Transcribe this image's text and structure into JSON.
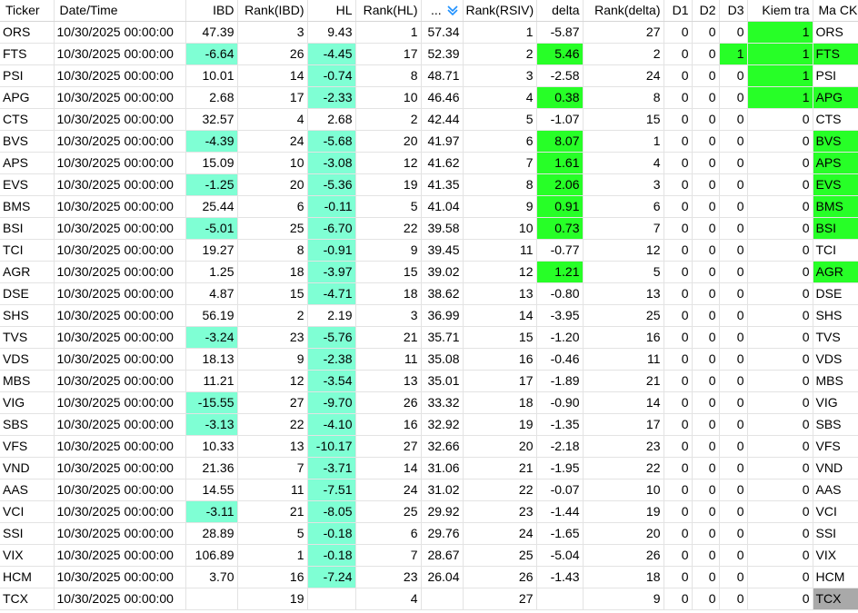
{
  "colors": {
    "aqua_highlight": "#7fffd4",
    "green_highlight": "#27ff27",
    "gray_highlight": "#a9a9a9",
    "sort_icon": "#1e90ff"
  },
  "columns": [
    {
      "key": "ticker",
      "label": "Ticker",
      "align": "left"
    },
    {
      "key": "datetime",
      "label": "Date/Time",
      "align": "left"
    },
    {
      "key": "ibd",
      "label": "IBD",
      "align": "right"
    },
    {
      "key": "rank_ibd",
      "label": "Rank(IBD)",
      "align": "right"
    },
    {
      "key": "hl",
      "label": "HL",
      "align": "right"
    },
    {
      "key": "rank_hl",
      "label": "Rank(HL)",
      "align": "right"
    },
    {
      "key": "rsiv",
      "label": "...",
      "align": "right",
      "sort_icon": "sort-descending-icon"
    },
    {
      "key": "rank_rsiv",
      "label": "Rank(RSIV)",
      "align": "right"
    },
    {
      "key": "delta",
      "label": "delta",
      "align": "right"
    },
    {
      "key": "rank_delta",
      "label": "Rank(delta)",
      "align": "right"
    },
    {
      "key": "d1",
      "label": "D1",
      "align": "right"
    },
    {
      "key": "d2",
      "label": "D2",
      "align": "right"
    },
    {
      "key": "d3",
      "label": "D3",
      "align": "right"
    },
    {
      "key": "kiem_tra",
      "label": "Kiem tra",
      "align": "right"
    },
    {
      "key": "ma_ck",
      "label": "Ma CK",
      "align": "left"
    }
  ],
  "rows": [
    {
      "ticker": "ORS",
      "datetime": "10/30/2025 00:00:00",
      "ibd": "47.39",
      "rank_ibd": "3",
      "hl": "9.43",
      "rank_hl": "1",
      "rsiv": "57.34",
      "rank_rsiv": "1",
      "delta": "-5.87",
      "rank_delta": "27",
      "d1": "0",
      "d2": "0",
      "d3": "0",
      "kiem_tra": "1",
      "ma_ck": "ORS",
      "hi": {
        "kiem_tra": "green"
      }
    },
    {
      "ticker": "FTS",
      "datetime": "10/30/2025 00:00:00",
      "ibd": "-6.64",
      "rank_ibd": "26",
      "hl": "-4.45",
      "rank_hl": "17",
      "rsiv": "52.39",
      "rank_rsiv": "2",
      "delta": "5.46",
      "rank_delta": "2",
      "d1": "0",
      "d2": "0",
      "d3": "1",
      "kiem_tra": "1",
      "ma_ck": "FTS",
      "hi": {
        "ibd": "aqua",
        "hl": "aqua",
        "delta": "green",
        "d3": "green",
        "kiem_tra": "green",
        "ma_ck": "green"
      }
    },
    {
      "ticker": "PSI",
      "datetime": "10/30/2025 00:00:00",
      "ibd": "10.01",
      "rank_ibd": "14",
      "hl": "-0.74",
      "rank_hl": "8",
      "rsiv": "48.71",
      "rank_rsiv": "3",
      "delta": "-2.58",
      "rank_delta": "24",
      "d1": "0",
      "d2": "0",
      "d3": "0",
      "kiem_tra": "1",
      "ma_ck": "PSI",
      "hi": {
        "hl": "aqua",
        "kiem_tra": "green"
      }
    },
    {
      "ticker": "APG",
      "datetime": "10/30/2025 00:00:00",
      "ibd": "2.68",
      "rank_ibd": "17",
      "hl": "-2.33",
      "rank_hl": "10",
      "rsiv": "46.46",
      "rank_rsiv": "4",
      "delta": "0.38",
      "rank_delta": "8",
      "d1": "0",
      "d2": "0",
      "d3": "0",
      "kiem_tra": "1",
      "ma_ck": "APG",
      "hi": {
        "hl": "aqua",
        "delta": "green",
        "kiem_tra": "green",
        "ma_ck": "green"
      }
    },
    {
      "ticker": "CTS",
      "datetime": "10/30/2025 00:00:00",
      "ibd": "32.57",
      "rank_ibd": "4",
      "hl": "2.68",
      "rank_hl": "2",
      "rsiv": "42.44",
      "rank_rsiv": "5",
      "delta": "-1.07",
      "rank_delta": "15",
      "d1": "0",
      "d2": "0",
      "d3": "0",
      "kiem_tra": "0",
      "ma_ck": "CTS",
      "hi": {}
    },
    {
      "ticker": "BVS",
      "datetime": "10/30/2025 00:00:00",
      "ibd": "-4.39",
      "rank_ibd": "24",
      "hl": "-5.68",
      "rank_hl": "20",
      "rsiv": "41.97",
      "rank_rsiv": "6",
      "delta": "8.07",
      "rank_delta": "1",
      "d1": "0",
      "d2": "0",
      "d3": "0",
      "kiem_tra": "0",
      "ma_ck": "BVS",
      "hi": {
        "ibd": "aqua",
        "hl": "aqua",
        "delta": "green",
        "ma_ck": "green"
      }
    },
    {
      "ticker": "APS",
      "datetime": "10/30/2025 00:00:00",
      "ibd": "15.09",
      "rank_ibd": "10",
      "hl": "-3.08",
      "rank_hl": "12",
      "rsiv": "41.62",
      "rank_rsiv": "7",
      "delta": "1.61",
      "rank_delta": "4",
      "d1": "0",
      "d2": "0",
      "d3": "0",
      "kiem_tra": "0",
      "ma_ck": "APS",
      "hi": {
        "hl": "aqua",
        "delta": "green",
        "ma_ck": "green"
      }
    },
    {
      "ticker": "EVS",
      "datetime": "10/30/2025 00:00:00",
      "ibd": "-1.25",
      "rank_ibd": "20",
      "hl": "-5.36",
      "rank_hl": "19",
      "rsiv": "41.35",
      "rank_rsiv": "8",
      "delta": "2.06",
      "rank_delta": "3",
      "d1": "0",
      "d2": "0",
      "d3": "0",
      "kiem_tra": "0",
      "ma_ck": "EVS",
      "hi": {
        "ibd": "aqua",
        "hl": "aqua",
        "delta": "green",
        "ma_ck": "green"
      }
    },
    {
      "ticker": "BMS",
      "datetime": "10/30/2025 00:00:00",
      "ibd": "25.44",
      "rank_ibd": "6",
      "hl": "-0.11",
      "rank_hl": "5",
      "rsiv": "41.04",
      "rank_rsiv": "9",
      "delta": "0.91",
      "rank_delta": "6",
      "d1": "0",
      "d2": "0",
      "d3": "0",
      "kiem_tra": "0",
      "ma_ck": "BMS",
      "hi": {
        "hl": "aqua",
        "delta": "green",
        "ma_ck": "green"
      }
    },
    {
      "ticker": "BSI",
      "datetime": "10/30/2025 00:00:00",
      "ibd": "-5.01",
      "rank_ibd": "25",
      "hl": "-6.70",
      "rank_hl": "22",
      "rsiv": "39.58",
      "rank_rsiv": "10",
      "delta": "0.73",
      "rank_delta": "7",
      "d1": "0",
      "d2": "0",
      "d3": "0",
      "kiem_tra": "0",
      "ma_ck": "BSI",
      "hi": {
        "ibd": "aqua",
        "hl": "aqua",
        "delta": "green",
        "ma_ck": "green"
      }
    },
    {
      "ticker": "TCI",
      "datetime": "10/30/2025 00:00:00",
      "ibd": "19.27",
      "rank_ibd": "8",
      "hl": "-0.91",
      "rank_hl": "9",
      "rsiv": "39.45",
      "rank_rsiv": "11",
      "delta": "-0.77",
      "rank_delta": "12",
      "d1": "0",
      "d2": "0",
      "d3": "0",
      "kiem_tra": "0",
      "ma_ck": "TCI",
      "hi": {
        "hl": "aqua"
      }
    },
    {
      "ticker": "AGR",
      "datetime": "10/30/2025 00:00:00",
      "ibd": "1.25",
      "rank_ibd": "18",
      "hl": "-3.97",
      "rank_hl": "15",
      "rsiv": "39.02",
      "rank_rsiv": "12",
      "delta": "1.21",
      "rank_delta": "5",
      "d1": "0",
      "d2": "0",
      "d3": "0",
      "kiem_tra": "0",
      "ma_ck": "AGR",
      "hi": {
        "hl": "aqua",
        "delta": "green",
        "ma_ck": "green"
      }
    },
    {
      "ticker": "DSE",
      "datetime": "10/30/2025 00:00:00",
      "ibd": "4.87",
      "rank_ibd": "15",
      "hl": "-4.71",
      "rank_hl": "18",
      "rsiv": "38.62",
      "rank_rsiv": "13",
      "delta": "-0.80",
      "rank_delta": "13",
      "d1": "0",
      "d2": "0",
      "d3": "0",
      "kiem_tra": "0",
      "ma_ck": "DSE",
      "hi": {
        "hl": "aqua"
      }
    },
    {
      "ticker": "SHS",
      "datetime": "10/30/2025 00:00:00",
      "ibd": "56.19",
      "rank_ibd": "2",
      "hl": "2.19",
      "rank_hl": "3",
      "rsiv": "36.99",
      "rank_rsiv": "14",
      "delta": "-3.95",
      "rank_delta": "25",
      "d1": "0",
      "d2": "0",
      "d3": "0",
      "kiem_tra": "0",
      "ma_ck": "SHS",
      "hi": {}
    },
    {
      "ticker": "TVS",
      "datetime": "10/30/2025 00:00:00",
      "ibd": "-3.24",
      "rank_ibd": "23",
      "hl": "-5.76",
      "rank_hl": "21",
      "rsiv": "35.71",
      "rank_rsiv": "15",
      "delta": "-1.20",
      "rank_delta": "16",
      "d1": "0",
      "d2": "0",
      "d3": "0",
      "kiem_tra": "0",
      "ma_ck": "TVS",
      "hi": {
        "ibd": "aqua",
        "hl": "aqua"
      }
    },
    {
      "ticker": "VDS",
      "datetime": "10/30/2025 00:00:00",
      "ibd": "18.13",
      "rank_ibd": "9",
      "hl": "-2.38",
      "rank_hl": "11",
      "rsiv": "35.08",
      "rank_rsiv": "16",
      "delta": "-0.46",
      "rank_delta": "11",
      "d1": "0",
      "d2": "0",
      "d3": "0",
      "kiem_tra": "0",
      "ma_ck": "VDS",
      "hi": {
        "hl": "aqua"
      }
    },
    {
      "ticker": "MBS",
      "datetime": "10/30/2025 00:00:00",
      "ibd": "11.21",
      "rank_ibd": "12",
      "hl": "-3.54",
      "rank_hl": "13",
      "rsiv": "35.01",
      "rank_rsiv": "17",
      "delta": "-1.89",
      "rank_delta": "21",
      "d1": "0",
      "d2": "0",
      "d3": "0",
      "kiem_tra": "0",
      "ma_ck": "MBS",
      "hi": {
        "hl": "aqua"
      }
    },
    {
      "ticker": "VIG",
      "datetime": "10/30/2025 00:00:00",
      "ibd": "-15.55",
      "rank_ibd": "27",
      "hl": "-9.70",
      "rank_hl": "26",
      "rsiv": "33.32",
      "rank_rsiv": "18",
      "delta": "-0.90",
      "rank_delta": "14",
      "d1": "0",
      "d2": "0",
      "d3": "0",
      "kiem_tra": "0",
      "ma_ck": "VIG",
      "hi": {
        "ibd": "aqua",
        "hl": "aqua"
      }
    },
    {
      "ticker": "SBS",
      "datetime": "10/30/2025 00:00:00",
      "ibd": "-3.13",
      "rank_ibd": "22",
      "hl": "-4.10",
      "rank_hl": "16",
      "rsiv": "32.92",
      "rank_rsiv": "19",
      "delta": "-1.35",
      "rank_delta": "17",
      "d1": "0",
      "d2": "0",
      "d3": "0",
      "kiem_tra": "0",
      "ma_ck": "SBS",
      "hi": {
        "ibd": "aqua",
        "hl": "aqua"
      }
    },
    {
      "ticker": "VFS",
      "datetime": "10/30/2025 00:00:00",
      "ibd": "10.33",
      "rank_ibd": "13",
      "hl": "-10.17",
      "rank_hl": "27",
      "rsiv": "32.66",
      "rank_rsiv": "20",
      "delta": "-2.18",
      "rank_delta": "23",
      "d1": "0",
      "d2": "0",
      "d3": "0",
      "kiem_tra": "0",
      "ma_ck": "VFS",
      "hi": {
        "hl": "aqua"
      }
    },
    {
      "ticker": "VND",
      "datetime": "10/30/2025 00:00:00",
      "ibd": "21.36",
      "rank_ibd": "7",
      "hl": "-3.71",
      "rank_hl": "14",
      "rsiv": "31.06",
      "rank_rsiv": "21",
      "delta": "-1.95",
      "rank_delta": "22",
      "d1": "0",
      "d2": "0",
      "d3": "0",
      "kiem_tra": "0",
      "ma_ck": "VND",
      "hi": {
        "hl": "aqua"
      }
    },
    {
      "ticker": "AAS",
      "datetime": "10/30/2025 00:00:00",
      "ibd": "14.55",
      "rank_ibd": "11",
      "hl": "-7.51",
      "rank_hl": "24",
      "rsiv": "31.02",
      "rank_rsiv": "22",
      "delta": "-0.07",
      "rank_delta": "10",
      "d1": "0",
      "d2": "0",
      "d3": "0",
      "kiem_tra": "0",
      "ma_ck": "AAS",
      "hi": {
        "hl": "aqua"
      }
    },
    {
      "ticker": "VCI",
      "datetime": "10/30/2025 00:00:00",
      "ibd": "-3.11",
      "rank_ibd": "21",
      "hl": "-8.05",
      "rank_hl": "25",
      "rsiv": "29.92",
      "rank_rsiv": "23",
      "delta": "-1.44",
      "rank_delta": "19",
      "d1": "0",
      "d2": "0",
      "d3": "0",
      "kiem_tra": "0",
      "ma_ck": "VCI",
      "hi": {
        "ibd": "aqua",
        "hl": "aqua"
      }
    },
    {
      "ticker": "SSI",
      "datetime": "10/30/2025 00:00:00",
      "ibd": "28.89",
      "rank_ibd": "5",
      "hl": "-0.18",
      "rank_hl": "6",
      "rsiv": "29.76",
      "rank_rsiv": "24",
      "delta": "-1.65",
      "rank_delta": "20",
      "d1": "0",
      "d2": "0",
      "d3": "0",
      "kiem_tra": "0",
      "ma_ck": "SSI",
      "hi": {
        "hl": "aqua"
      }
    },
    {
      "ticker": "VIX",
      "datetime": "10/30/2025 00:00:00",
      "ibd": "106.89",
      "rank_ibd": "1",
      "hl": "-0.18",
      "rank_hl": "7",
      "rsiv": "28.67",
      "rank_rsiv": "25",
      "delta": "-5.04",
      "rank_delta": "26",
      "d1": "0",
      "d2": "0",
      "d3": "0",
      "kiem_tra": "0",
      "ma_ck": "VIX",
      "hi": {
        "hl": "aqua"
      }
    },
    {
      "ticker": "HCM",
      "datetime": "10/30/2025 00:00:00",
      "ibd": "3.70",
      "rank_ibd": "16",
      "hl": "-7.24",
      "rank_hl": "23",
      "rsiv": "26.04",
      "rank_rsiv": "26",
      "delta": "-1.43",
      "rank_delta": "18",
      "d1": "0",
      "d2": "0",
      "d3": "0",
      "kiem_tra": "0",
      "ma_ck": "HCM",
      "hi": {
        "hl": "aqua"
      }
    },
    {
      "ticker": "TCX",
      "datetime": "10/30/2025 00:00:00",
      "ibd": "",
      "rank_ibd": "19",
      "hl": "",
      "rank_hl": "4",
      "rsiv": "",
      "rank_rsiv": "27",
      "delta": "",
      "rank_delta": "9",
      "d1": "0",
      "d2": "0",
      "d3": "0",
      "kiem_tra": "0",
      "ma_ck": "TCX",
      "hi": {
        "ma_ck": "gray"
      }
    }
  ]
}
